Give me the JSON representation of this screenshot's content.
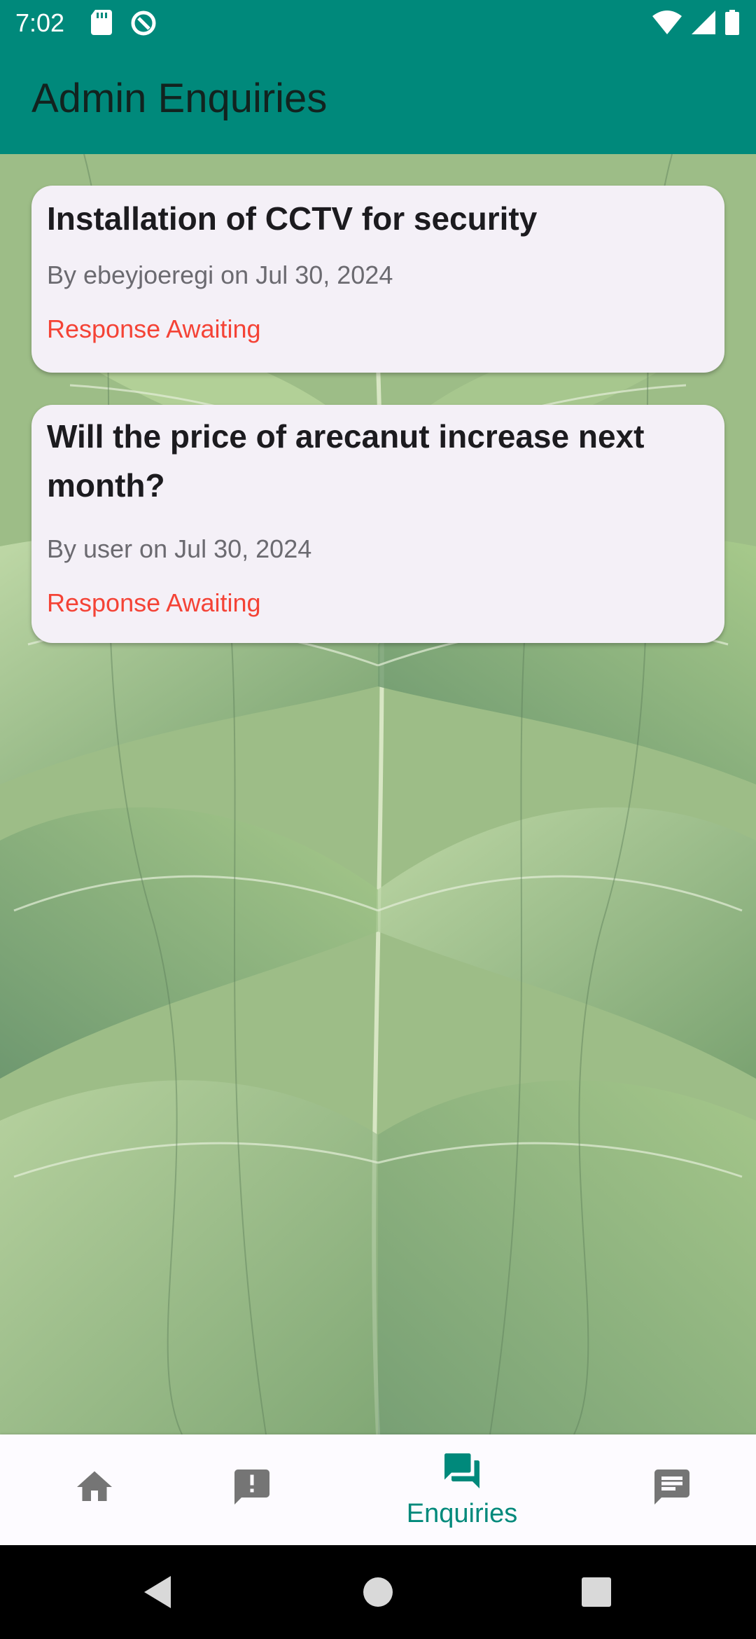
{
  "status_bar": {
    "time": "7:02",
    "left_icons": [
      "sd-card-icon",
      "sync-icon"
    ],
    "right_icons": [
      "wifi-icon",
      "signal-icon",
      "battery-icon"
    ]
  },
  "app_bar": {
    "title": "Admin Enquiries"
  },
  "enquiries": [
    {
      "title": "Installation of CCTV for security",
      "meta": "By ebeyjoeregi on Jul 30, 2024",
      "status": "Response Awaiting"
    },
    {
      "title": "Will the price of arecanut increase next month?",
      "meta": "By user on Jul 30, 2024",
      "status": "Response Awaiting"
    }
  ],
  "bottom_nav": {
    "items": [
      {
        "icon": "home-icon",
        "label": ""
      },
      {
        "icon": "report-icon",
        "label": ""
      },
      {
        "icon": "forum-icon",
        "label": "Enquiries",
        "selected": true
      },
      {
        "icon": "feed-icon",
        "label": ""
      }
    ]
  },
  "colors": {
    "primary": "#00897b",
    "card_bg": "#f4f0f7",
    "status_red": "#f44336",
    "meta_gray": "#6b6a70"
  }
}
